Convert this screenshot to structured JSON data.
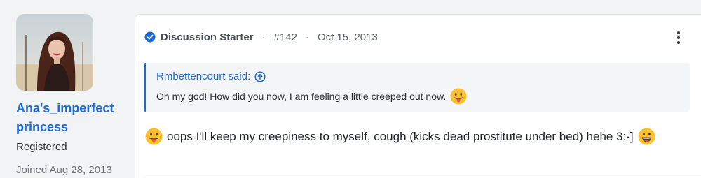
{
  "user": {
    "name": "Ana's_imperfect princess",
    "title": "Registered",
    "joined": "Joined Aug 28, 2013"
  },
  "post": {
    "badge": "Discussion Starter",
    "separator": "·",
    "number": "#142",
    "date": "Oct 15, 2013",
    "quote": {
      "author": "Rmbettencourt said:",
      "text": "Oh my god! How did you now, I am feeling a little creeped out now."
    },
    "message": "oops I'll keep my creepiness to myself, cough (kicks dead prostitute under bed) hehe 3:-]"
  },
  "icons": {
    "badge": "check-circle-icon",
    "quote_link": "arrow-up-circle-icon",
    "menu": "more-vertical-icon",
    "emoji_tongue": "tongue-out-emoji",
    "emoji_grin": "grin-emoji"
  },
  "colors": {
    "accent": "#1a6ad6",
    "page_bg": "#f2f3f5",
    "card_bg": "#ffffff",
    "quote_bg": "#f4f5f6",
    "emoji_yellow": "#fbc02d"
  }
}
